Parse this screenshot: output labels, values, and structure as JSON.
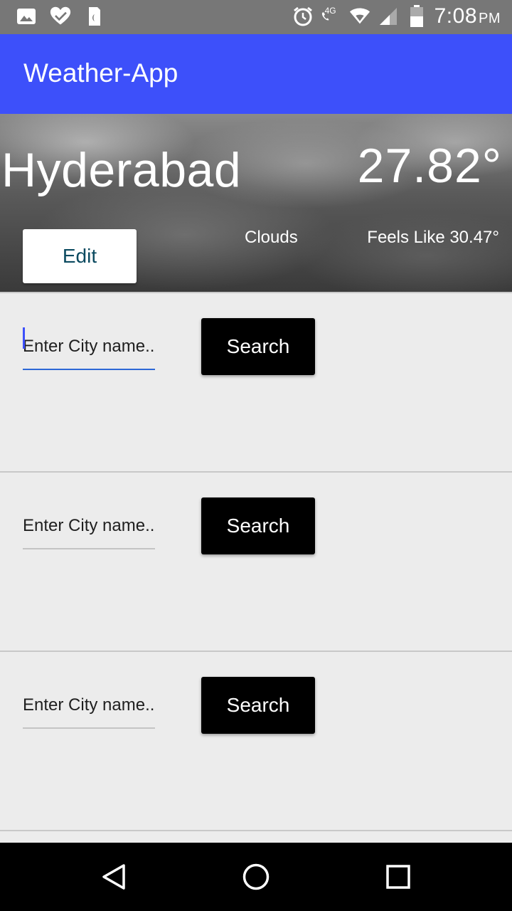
{
  "status_bar": {
    "time": "7:08",
    "ampm": "PM",
    "network": "4G",
    "left_icons": [
      "image-icon",
      "heart-check-icon",
      "sim-icon"
    ],
    "right_icons": [
      "alarm-icon",
      "call-icon",
      "wifi-icon",
      "signal-icon",
      "battery-icon"
    ]
  },
  "app_bar": {
    "title": "Weather-App",
    "color": "#3d50fa"
  },
  "weather": {
    "city": "Hyderabad",
    "temperature": "27.82°",
    "condition": "Clouds",
    "feels_like": "Feels Like 30.47°",
    "edit_label": "Edit"
  },
  "cards": [
    {
      "placeholder": "Enter City name...",
      "value": "",
      "search_label": "Search",
      "focused": true
    },
    {
      "placeholder": "Enter City name...",
      "value": "",
      "search_label": "Search",
      "focused": false
    },
    {
      "placeholder": "Enter City name...",
      "value": "",
      "search_label": "Search",
      "focused": false
    }
  ],
  "nav_bar": {
    "buttons": [
      "back-icon",
      "home-icon",
      "recents-icon"
    ]
  }
}
